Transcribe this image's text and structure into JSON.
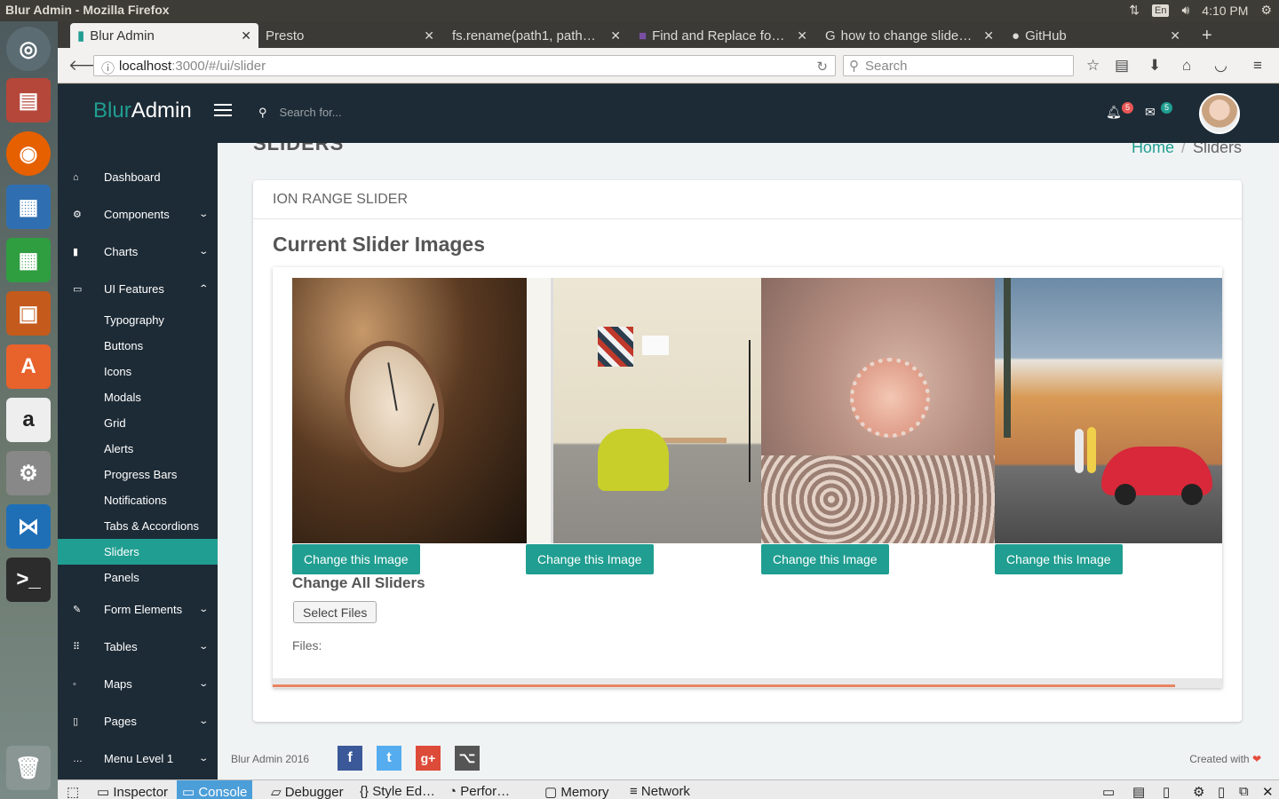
{
  "os": {
    "window_title": "Blur Admin - Mozilla Firefox",
    "keyboard": "En",
    "time": "4:10 PM"
  },
  "browser": {
    "tabs": [
      {
        "label": "Blur Admin"
      },
      {
        "label": "Presto"
      },
      {
        "label": "fs.rename(path1, path…"
      },
      {
        "label": "Find and Replace fo…"
      },
      {
        "label": "how to change slide…"
      },
      {
        "label": "GitHub"
      }
    ],
    "url_host": "localhost",
    "url_rest": ":3000/#/ui/slider",
    "search_placeholder": "Search"
  },
  "app": {
    "brand_part1": "Blur",
    "brand_part2": "Admin",
    "search_placeholder": "Search for...",
    "notif_count": "5",
    "msg_count": "5",
    "sidebar": [
      {
        "label": "Dashboard",
        "icon": "home-icon",
        "glyph": "⌂"
      },
      {
        "label": "Components",
        "icon": "gear-icon",
        "glyph": "⚙",
        "chev": "⌄"
      },
      {
        "label": "Charts",
        "icon": "bar-chart-icon",
        "glyph": "▮",
        "chev": "⌄"
      },
      {
        "label": "UI Features",
        "icon": "laptop-icon",
        "glyph": "▭",
        "chev": "⌃"
      },
      {
        "label": "Typography"
      },
      {
        "label": "Buttons"
      },
      {
        "label": "Icons"
      },
      {
        "label": "Modals"
      },
      {
        "label": "Grid"
      },
      {
        "label": "Alerts"
      },
      {
        "label": "Progress Bars"
      },
      {
        "label": "Notifications"
      },
      {
        "label": "Tabs & Accordions"
      },
      {
        "label": "Sliders"
      },
      {
        "label": "Panels"
      },
      {
        "label": "Form Elements",
        "icon": "edit-icon",
        "glyph": "✎",
        "chev": "⌄"
      },
      {
        "label": "Tables",
        "icon": "grid-icon",
        "glyph": "⠿",
        "chev": "⌄"
      },
      {
        "label": "Maps",
        "icon": "map-pin-icon",
        "glyph": "◦",
        "chev": "⌄"
      },
      {
        "label": "Pages",
        "icon": "file-icon",
        "glyph": "▯",
        "chev": "⌄"
      },
      {
        "label": "Menu Level 1",
        "icon": "ellipsis-icon",
        "glyph": "…",
        "chev": "⌄"
      }
    ],
    "page_title": "SLIDERS",
    "breadcrumb": {
      "home": "Home",
      "sep": "/",
      "current": "Sliders"
    },
    "card_title": "ION RANGE SLIDER",
    "section_title": "Current Slider Images",
    "slides": [
      {
        "alt": "watch",
        "button": "Change this Image"
      },
      {
        "alt": "desk-chair",
        "button": "Change this Image"
      },
      {
        "alt": "ring",
        "button": "Change this Image"
      },
      {
        "alt": "red-beetle-car",
        "button": "Change this Image"
      }
    ],
    "change_all": "Change All Sliders",
    "select_files": "Select Files",
    "files_label": "Files:",
    "progress": 0.95,
    "footer": {
      "copy": "Blur Admin 2016",
      "made": "Created with",
      "heart": "❤"
    },
    "social": [
      {
        "icon": "facebook-icon",
        "glyph": "f",
        "color": "#3b5998"
      },
      {
        "icon": "twitter-icon",
        "glyph": "t",
        "color": "#55acee"
      },
      {
        "icon": "google-plus-icon",
        "glyph": "g+",
        "color": "#dd4b39"
      },
      {
        "icon": "github-icon",
        "glyph": "⌥",
        "color": "#555"
      }
    ]
  },
  "devtools": {
    "tabs": [
      "Inspector",
      "Console",
      "Debugger",
      "Style Ed…",
      "Perfor…",
      "Memory",
      "Network"
    ],
    "active": "Console"
  }
}
